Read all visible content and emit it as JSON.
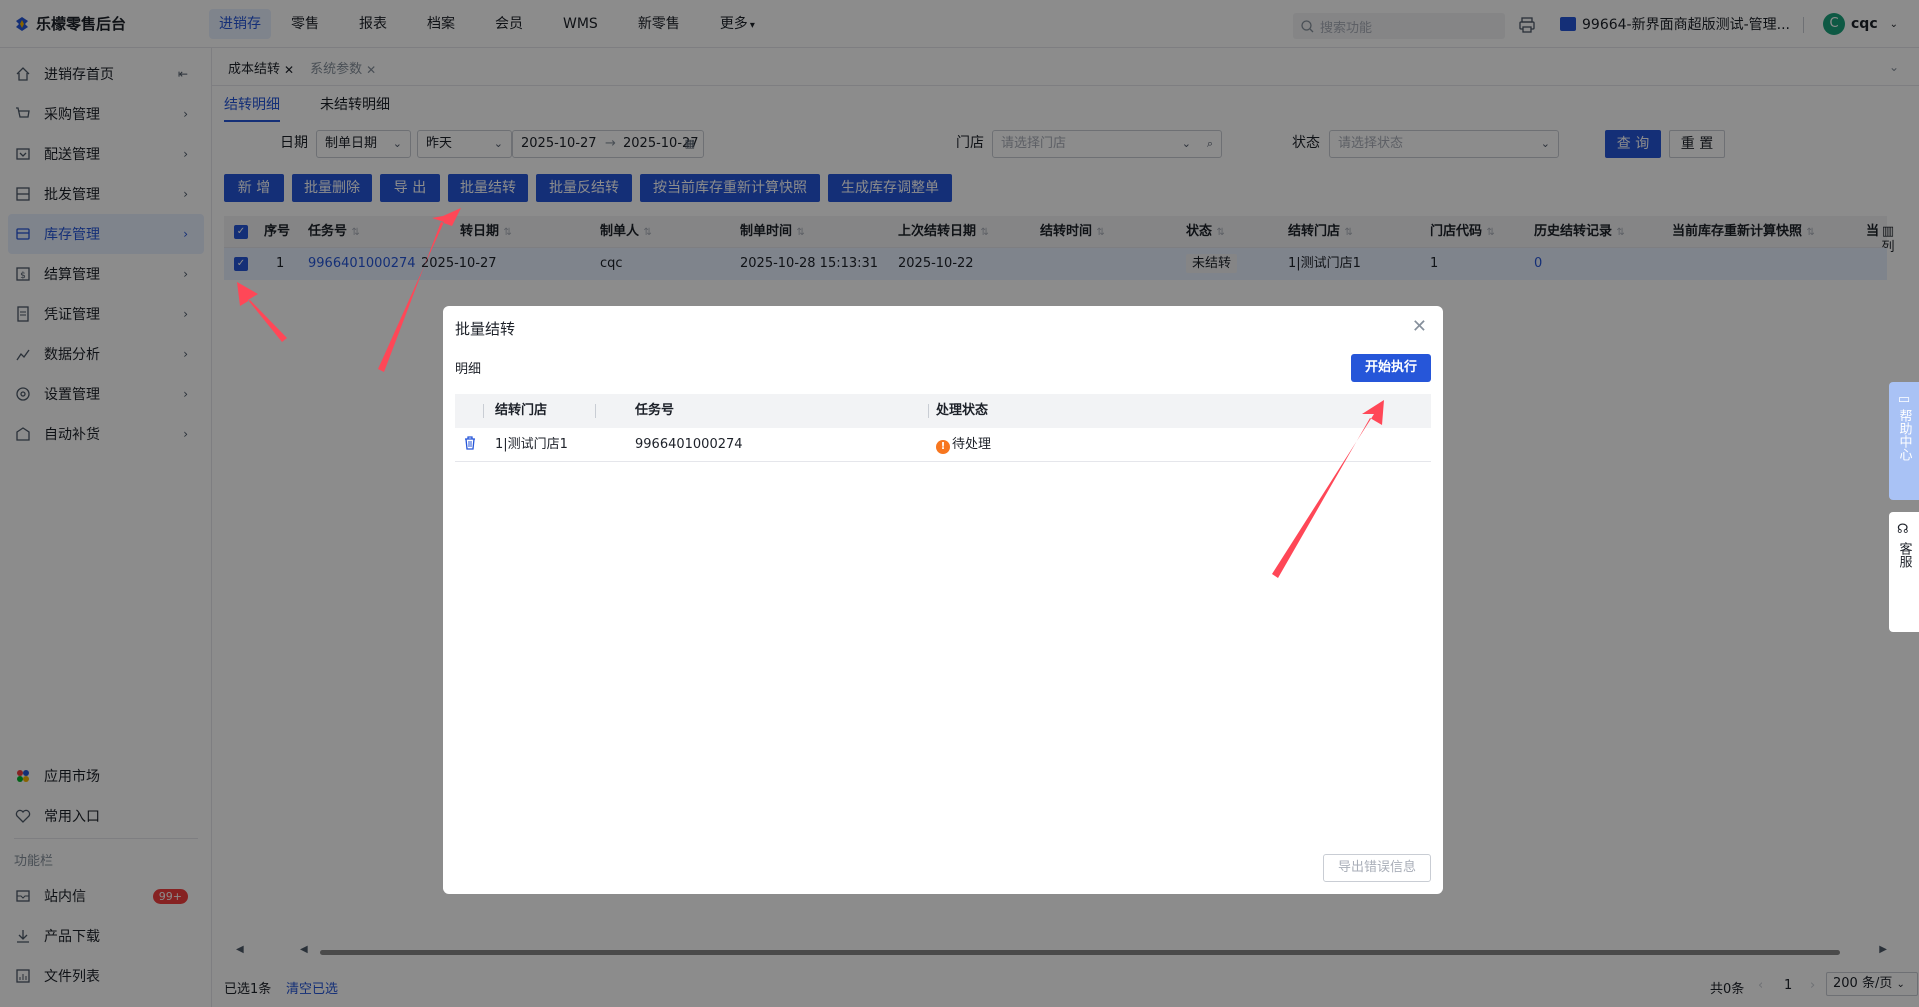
{
  "app": {
    "title": "乐檬零售后台"
  },
  "topnav": {
    "items": [
      "进销存",
      "零售",
      "报表",
      "档案",
      "会员",
      "WMS",
      "新零售",
      "更多"
    ],
    "search_placeholder": "搜索功能",
    "store": "99664-新界面商超版测试-管理...",
    "user_avatar": "C",
    "user": "cqc"
  },
  "sidebar": {
    "items": [
      {
        "label": "进销存首页",
        "icon": "home-icon"
      },
      {
        "label": "采购管理",
        "icon": "cart-icon"
      },
      {
        "label": "配送管理",
        "icon": "delivery-icon"
      },
      {
        "label": "批发管理",
        "icon": "wholesale-icon"
      },
      {
        "label": "库存管理",
        "icon": "inventory-icon"
      },
      {
        "label": "结算管理",
        "icon": "settlement-icon"
      },
      {
        "label": "凭证管理",
        "icon": "voucher-icon"
      },
      {
        "label": "数据分析",
        "icon": "chart-icon"
      },
      {
        "label": "设置管理",
        "icon": "settings-icon"
      },
      {
        "label": "自动补货",
        "icon": "replenish-icon"
      }
    ],
    "app_market": "应用市场",
    "common_entry": "常用入口",
    "func_caption": "功能栏",
    "inbox": "站内信",
    "inbox_badge": "99+",
    "download": "产品下载",
    "files": "文件列表"
  },
  "tabs": {
    "active": "成本结转",
    "other": "系统参数"
  },
  "subtabs": {
    "active": "结转明细",
    "other": "未结转明细"
  },
  "filters": {
    "date_label": "日期",
    "date_type": "制单日期",
    "date_range": "昨天",
    "date_start": "2025-10-27",
    "date_end": "2025-10-27",
    "store_label": "门店",
    "store_placeholder": "请选择门店",
    "status_label": "状态",
    "status_placeholder": "请选择状态",
    "query_btn": "查 询",
    "reset_btn": "重 置"
  },
  "toolbar": {
    "add": "新 增",
    "batch_delete": "批量删除",
    "export": "导 出",
    "batch_transfer": "批量结转",
    "batch_reverse": "批量反结转",
    "recalc": "按当前库存重新计算快照",
    "gen_adjust": "生成库存调整单"
  },
  "table": {
    "headers": [
      "序号",
      "任务号",
      "转日期",
      "制单人",
      "制单时间",
      "上次结转日期",
      "结转时间",
      "状态",
      "结转门店",
      "门店代码",
      "历史结转记录",
      "当前库存重新计算快照",
      "当"
    ],
    "row": {
      "seq": "1",
      "task": "9966401000274",
      "date": "2025-10-27",
      "maker": "cqc",
      "make_time": "2025-10-28 15:13:31",
      "last_date": "2025-10-22",
      "transfer_time": "",
      "status": "未结转",
      "store": "1|测试门店1",
      "store_code": "1",
      "history": "0"
    },
    "col_menu": "列"
  },
  "footer": {
    "selected": "已选1条",
    "clear": "清空已选",
    "total": "共0条",
    "page": "1",
    "page_size": "200 条/页"
  },
  "modal": {
    "title": "批量结转",
    "subtitle": "明细",
    "exec_btn": "开始执行",
    "headers": [
      "结转门店",
      "任务号",
      "处理状态"
    ],
    "row": {
      "store": "1|测试门店1",
      "task": "9966401000274",
      "status": "待处理"
    },
    "export_err_btn": "导出错误信息"
  },
  "floating": {
    "help": "帮助中心",
    "service": "客服"
  },
  "colors": {
    "primary": "#2656d9",
    "arrow": "#ff4757",
    "warn": "#f7761f"
  }
}
